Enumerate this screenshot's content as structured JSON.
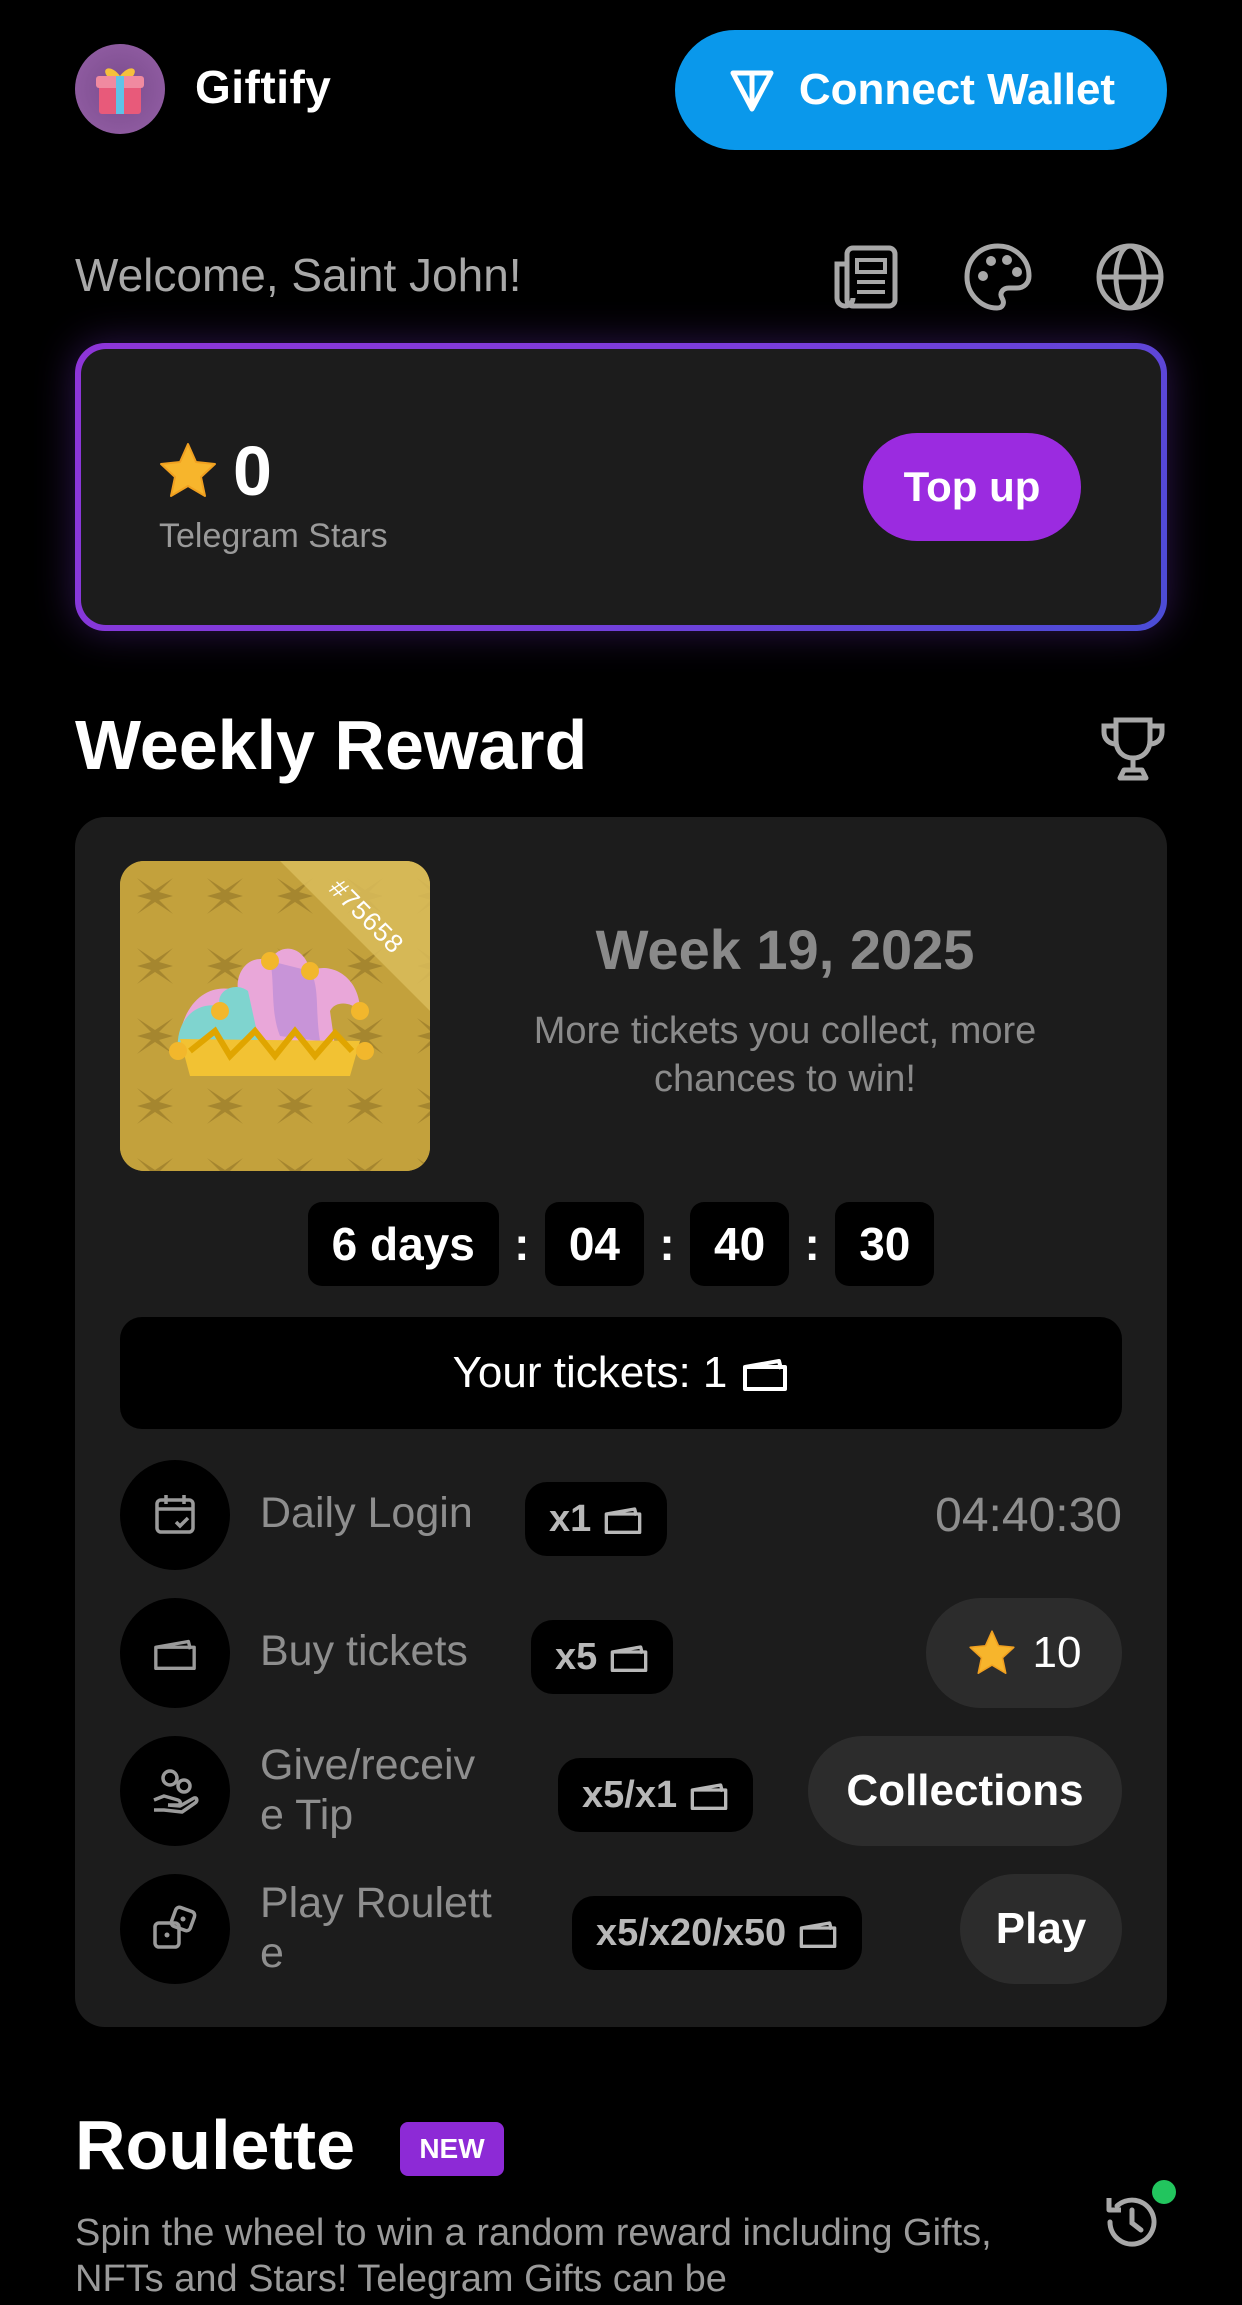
{
  "header": {
    "app_name": "Giftify",
    "connect_label": "Connect Wallet",
    "logo_icon": "gift-icon",
    "wallet_icon": "ton-icon"
  },
  "welcome": {
    "text": "Welcome, Saint John!",
    "icons": [
      "news-icon",
      "palette-icon",
      "globe-icon"
    ]
  },
  "stars": {
    "value": "0",
    "label": "Telegram Stars",
    "topup_label": "Top up"
  },
  "weekly": {
    "title": "Weekly Reward",
    "gift_number": "#75658",
    "week_title": "Week 19, 2025",
    "subtitle": "More tickets you collect, more chances to win!",
    "timer": {
      "days": "6 days",
      "hours": "04",
      "minutes": "40",
      "seconds": "30",
      "sep": ":"
    },
    "tickets_label": "Your tickets: 1",
    "tasks": [
      {
        "label": "Daily Login",
        "multiplier": "x1",
        "right_text": "04:40:30"
      },
      {
        "label": "Buy tickets",
        "multiplier": "x5",
        "button": "10"
      },
      {
        "label": "Give/receiv e Tip",
        "label_line1": "Give/receiv",
        "label_line2": "e Tip",
        "multiplier": "x5/x1",
        "button": "Collections"
      },
      {
        "label": "Play Roulett e",
        "label_line1": "Play Roulett",
        "label_line2": "e",
        "multiplier": "x5/x20/x50",
        "button": "Play"
      }
    ]
  },
  "roulette": {
    "title": "Roulette",
    "badge": "NEW",
    "description": "Spin the wheel to win a random reward including Gifts, NFTs and Stars! Telegram Gifts can be"
  },
  "colors": {
    "wallet_blue": "#0a98eb",
    "topup_purple": "#9b2be0",
    "card_bg": "#1c1c1c",
    "status_green": "#22c55e"
  }
}
